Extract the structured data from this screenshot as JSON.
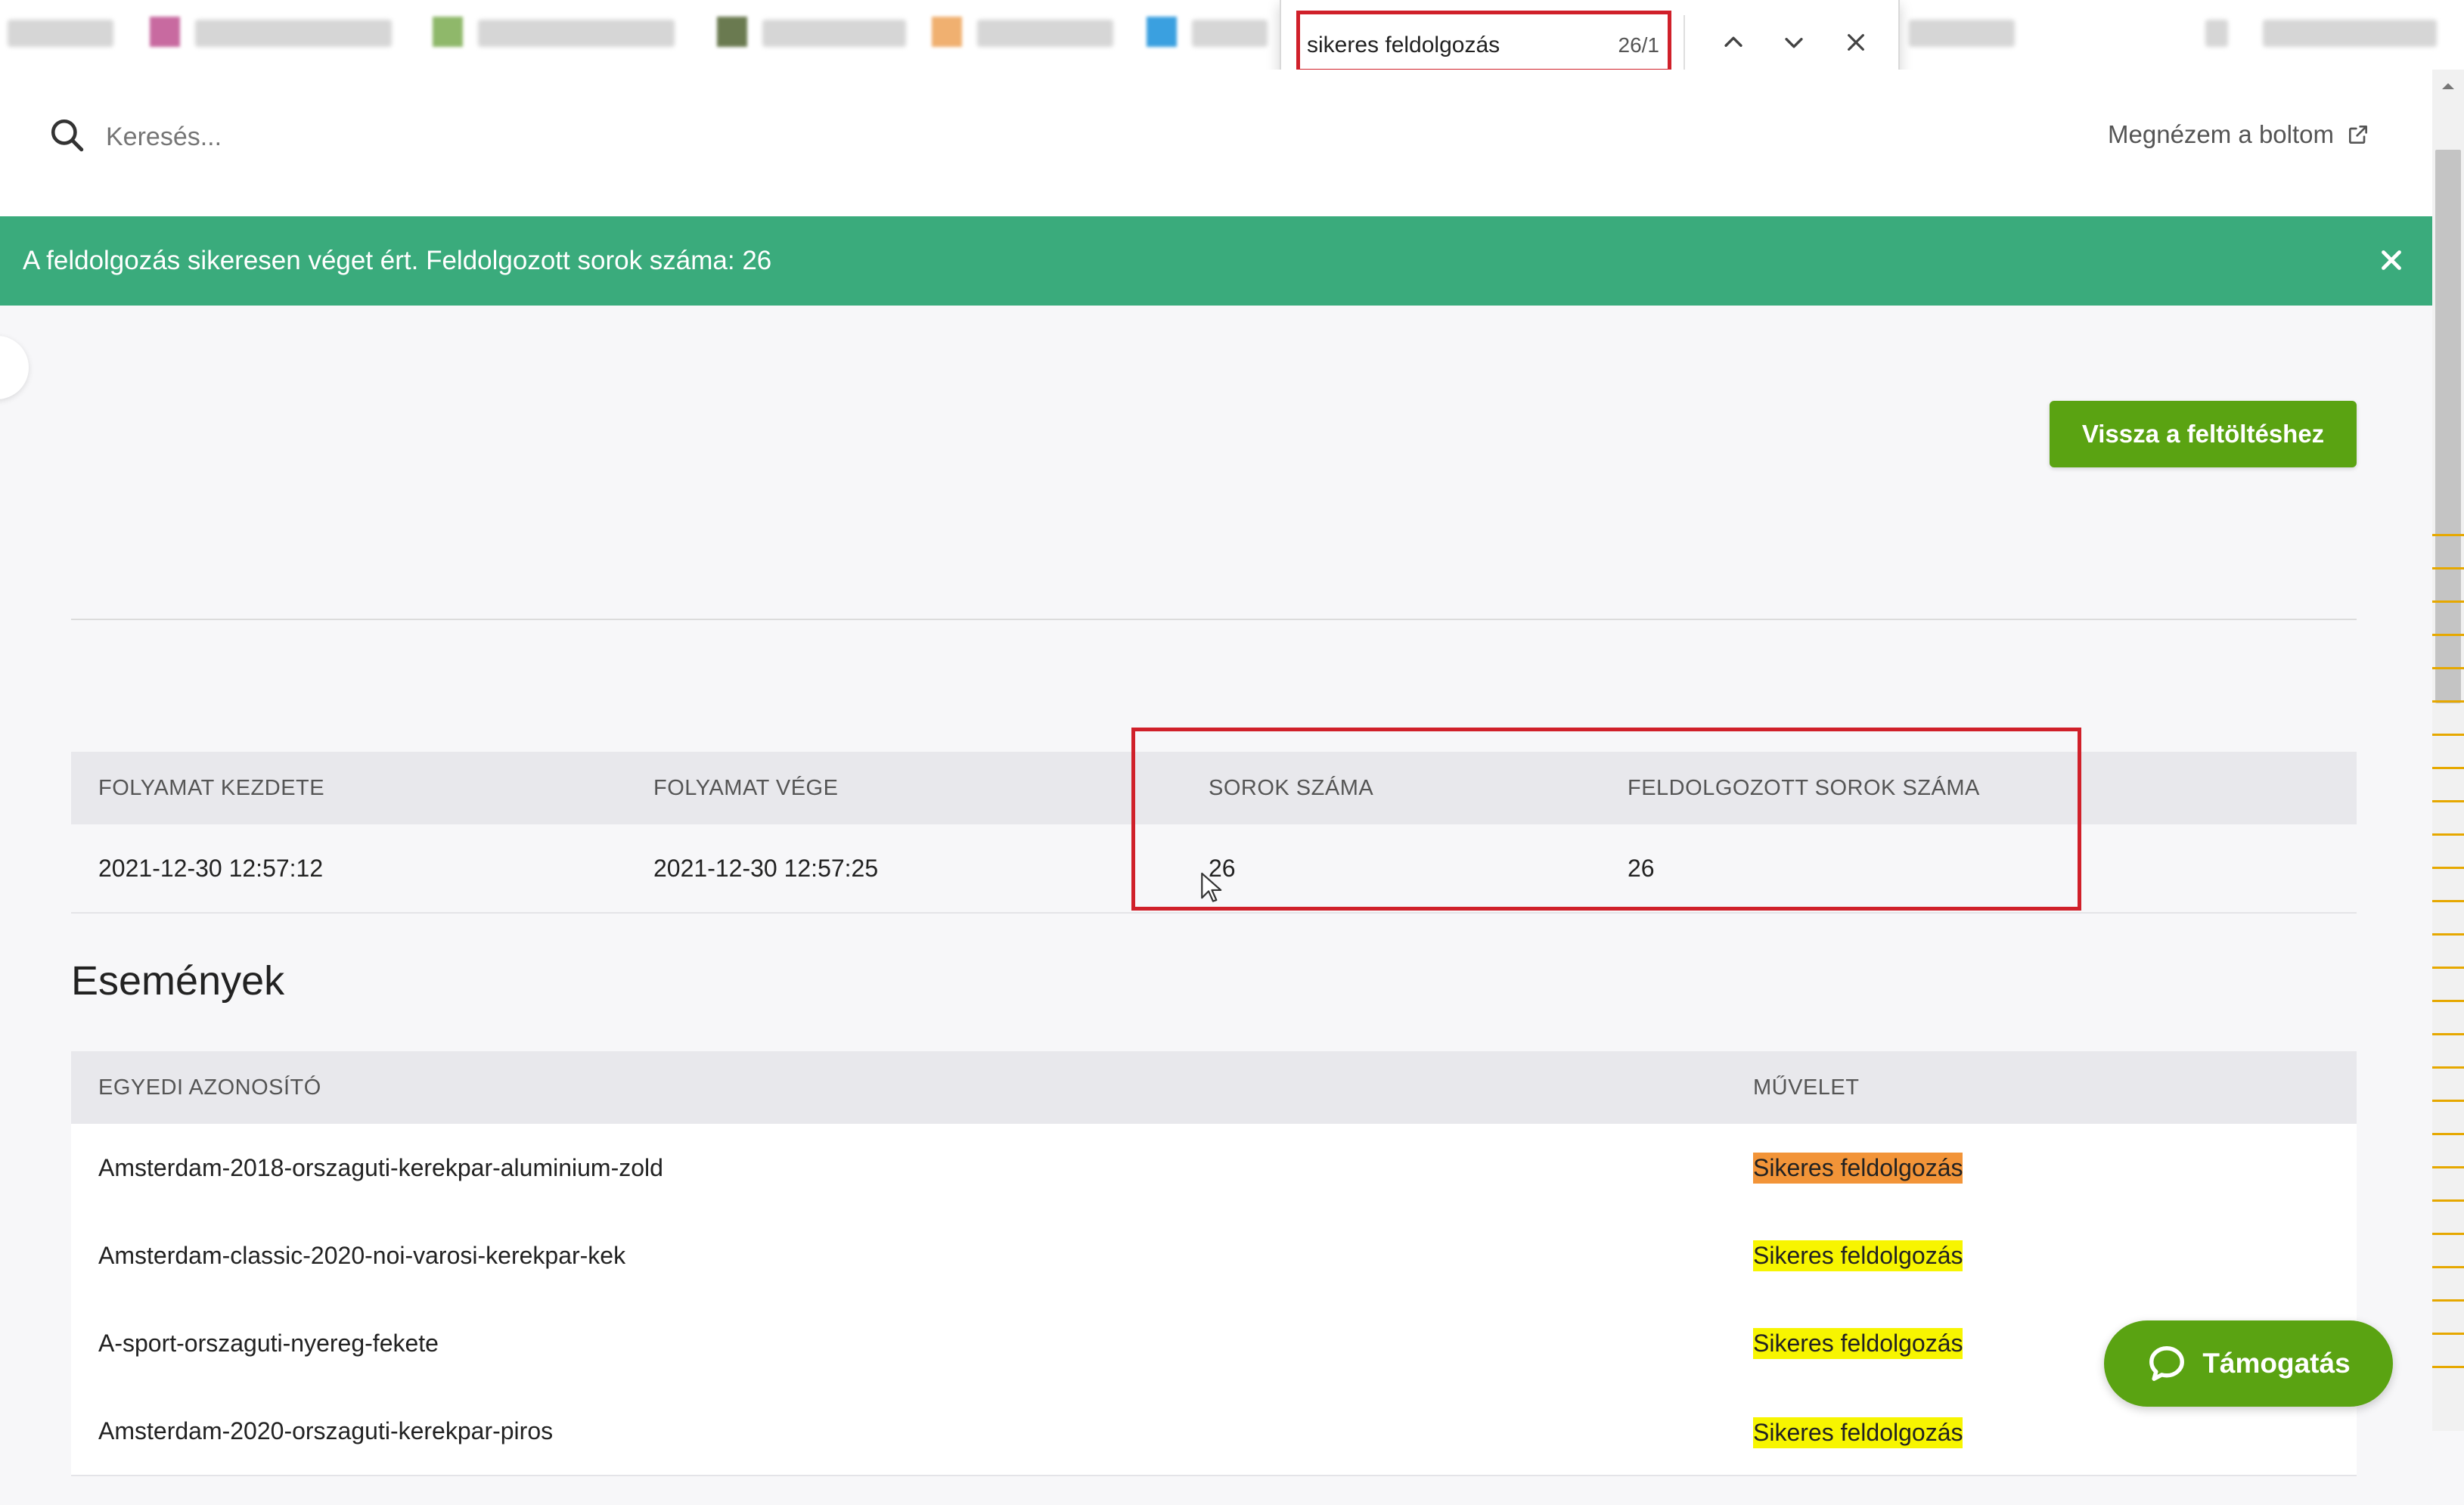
{
  "find_bar": {
    "query": "sikeres feldolgozás",
    "count": "26/1",
    "prev_icon": "chevron-up-icon",
    "next_icon": "chevron-down-icon",
    "close_icon": "close-icon"
  },
  "header": {
    "search_placeholder": "Keresés...",
    "store_link": "Megnézem a boltom"
  },
  "banner": {
    "message": "A feldolgozás sikeresen véget ért. Feldolgozott sorok száma: 26",
    "color": "#3aab7c"
  },
  "back_button": "Vissza a feltöltéshez",
  "summary_table": {
    "headers": [
      "FOLYAMAT KEZDETE",
      "FOLYAMAT VÉGE",
      "SOROK SZÁMA",
      "FELDOLGOZOTT SOROK SZÁMA"
    ],
    "row": [
      "2021-12-30 12:57:12",
      "2021-12-30 12:57:25",
      "26",
      "26"
    ]
  },
  "events": {
    "title": "Események",
    "headers": [
      "EGYEDI AZONOSÍTÓ",
      "MŰVELET"
    ],
    "rows": [
      {
        "id": "Amsterdam-2018-orszaguti-kerekpar-aluminium-zold",
        "action": "Sikeres feldolgozás"
      },
      {
        "id": "Amsterdam-classic-2020-noi-varosi-kerekpar-kek",
        "action": "Sikeres feldolgozás"
      },
      {
        "id": "A-sport-orszaguti-nyereg-fekete",
        "action": "Sikeres feldolgozás"
      },
      {
        "id": "Amsterdam-2020-orszaguti-kerekpar-piros",
        "action": "Sikeres feldolgozás"
      }
    ]
  },
  "support_button": "Támogatás",
  "colors": {
    "accent_green": "#5aa312",
    "highlight_active": "#f29438",
    "highlight": "#f7f500",
    "annotation_red": "#d0202a"
  }
}
